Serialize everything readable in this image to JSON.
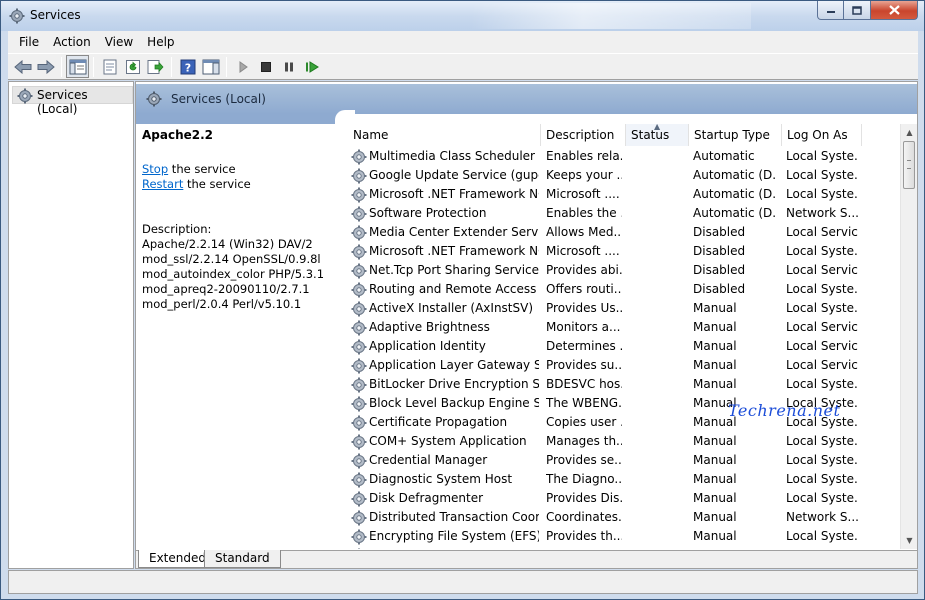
{
  "window": {
    "title": "Services"
  },
  "menu": [
    "File",
    "Action",
    "View",
    "Help"
  ],
  "toolbar": {
    "buttons": [
      "back-arrow",
      "forward-arrow",
      "show-console-tree",
      "properties",
      "refresh",
      "export-list",
      "help",
      "show-action-pane",
      "start",
      "stop",
      "pause",
      "restart"
    ]
  },
  "tree": {
    "root_label": "Services (Local)"
  },
  "main": {
    "header_label": "Services (Local)"
  },
  "details": {
    "service_name": "Apache2.2",
    "stop_link": "Stop",
    "stop_rest": " the service",
    "restart_link": "Restart",
    "restart_rest": " the service",
    "description_label": "Description:",
    "description_lines": [
      "Apache/2.2.14 (Win32) DAV/2",
      "mod_ssl/2.2.14 OpenSSL/0.9.8l",
      "mod_autoindex_color PHP/5.3.1",
      "mod_apreq2-20090110/2.7.1",
      "mod_perl/2.0.4 Perl/v5.10.1"
    ]
  },
  "columns": [
    "Name",
    "Description",
    "Status",
    "Startup Type",
    "Log On As"
  ],
  "sorted_column": "Status",
  "services": [
    {
      "name": "Multimedia Class Scheduler",
      "desc": "Enables rela...",
      "status": "",
      "startup": "Automatic",
      "logon": "Local Syste..."
    },
    {
      "name": "Google Update Service (gupdate)",
      "desc": "Keeps your ...",
      "status": "",
      "startup": "Automatic (D...",
      "logon": "Local Syste..."
    },
    {
      "name": "Microsoft .NET Framework NGEN",
      "desc": "Microsoft ....",
      "status": "",
      "startup": "Automatic (D...",
      "logon": "Local Syste..."
    },
    {
      "name": "Software Protection",
      "desc": "Enables the ...",
      "status": "",
      "startup": "Automatic (D...",
      "logon": "Network S..."
    },
    {
      "name": "Media Center Extender Service",
      "desc": "Allows Med...",
      "status": "",
      "startup": "Disabled",
      "logon": "Local Service"
    },
    {
      "name": "Microsoft .NET Framework NGEN",
      "desc": "Microsoft ....",
      "status": "",
      "startup": "Disabled",
      "logon": "Local Syste..."
    },
    {
      "name": "Net.Tcp Port Sharing Service",
      "desc": "Provides abi...",
      "status": "",
      "startup": "Disabled",
      "logon": "Local Service"
    },
    {
      "name": "Routing and Remote Access",
      "desc": "Offers routi...",
      "status": "",
      "startup": "Disabled",
      "logon": "Local Syste..."
    },
    {
      "name": "ActiveX Installer (AxInstSV)",
      "desc": "Provides Us...",
      "status": "",
      "startup": "Manual",
      "logon": "Local Syste..."
    },
    {
      "name": "Adaptive Brightness",
      "desc": "Monitors a...",
      "status": "",
      "startup": "Manual",
      "logon": "Local Service"
    },
    {
      "name": "Application Identity",
      "desc": "Determines ...",
      "status": "",
      "startup": "Manual",
      "logon": "Local Service"
    },
    {
      "name": "Application Layer Gateway Service",
      "desc": "Provides su...",
      "status": "",
      "startup": "Manual",
      "logon": "Local Service"
    },
    {
      "name": "BitLocker Drive Encryption Service",
      "desc": "BDESVC hos...",
      "status": "",
      "startup": "Manual",
      "logon": "Local Syste..."
    },
    {
      "name": "Block Level Backup Engine Service",
      "desc": "The WBENG...",
      "status": "",
      "startup": "Manual",
      "logon": "Local Syste..."
    },
    {
      "name": "Certificate Propagation",
      "desc": "Copies user ...",
      "status": "",
      "startup": "Manual",
      "logon": "Local Syste..."
    },
    {
      "name": "COM+ System Application",
      "desc": "Manages th...",
      "status": "",
      "startup": "Manual",
      "logon": "Local Syste..."
    },
    {
      "name": "Credential Manager",
      "desc": "Provides se...",
      "status": "",
      "startup": "Manual",
      "logon": "Local Syste..."
    },
    {
      "name": "Diagnostic System Host",
      "desc": "The Diagno...",
      "status": "",
      "startup": "Manual",
      "logon": "Local Syste..."
    },
    {
      "name": "Disk Defragmenter",
      "desc": "Provides Dis...",
      "status": "",
      "startup": "Manual",
      "logon": "Local Syste..."
    },
    {
      "name": "Distributed Transaction Coordinator",
      "desc": "Coordinates...",
      "status": "",
      "startup": "Manual",
      "logon": "Network S..."
    },
    {
      "name": "Encrypting File System (EFS)",
      "desc": "Provides th...",
      "status": "",
      "startup": "Manual",
      "logon": "Local Syste..."
    },
    {
      "name": "",
      "desc": "",
      "status": "",
      "startup": "",
      "logon": ""
    }
  ],
  "tabs": [
    "Extended",
    "Standard"
  ],
  "watermark": "Techrena.net",
  "colors": {
    "header": "#8eaad0",
    "link": "#0066cc",
    "close": "#c9452d"
  }
}
